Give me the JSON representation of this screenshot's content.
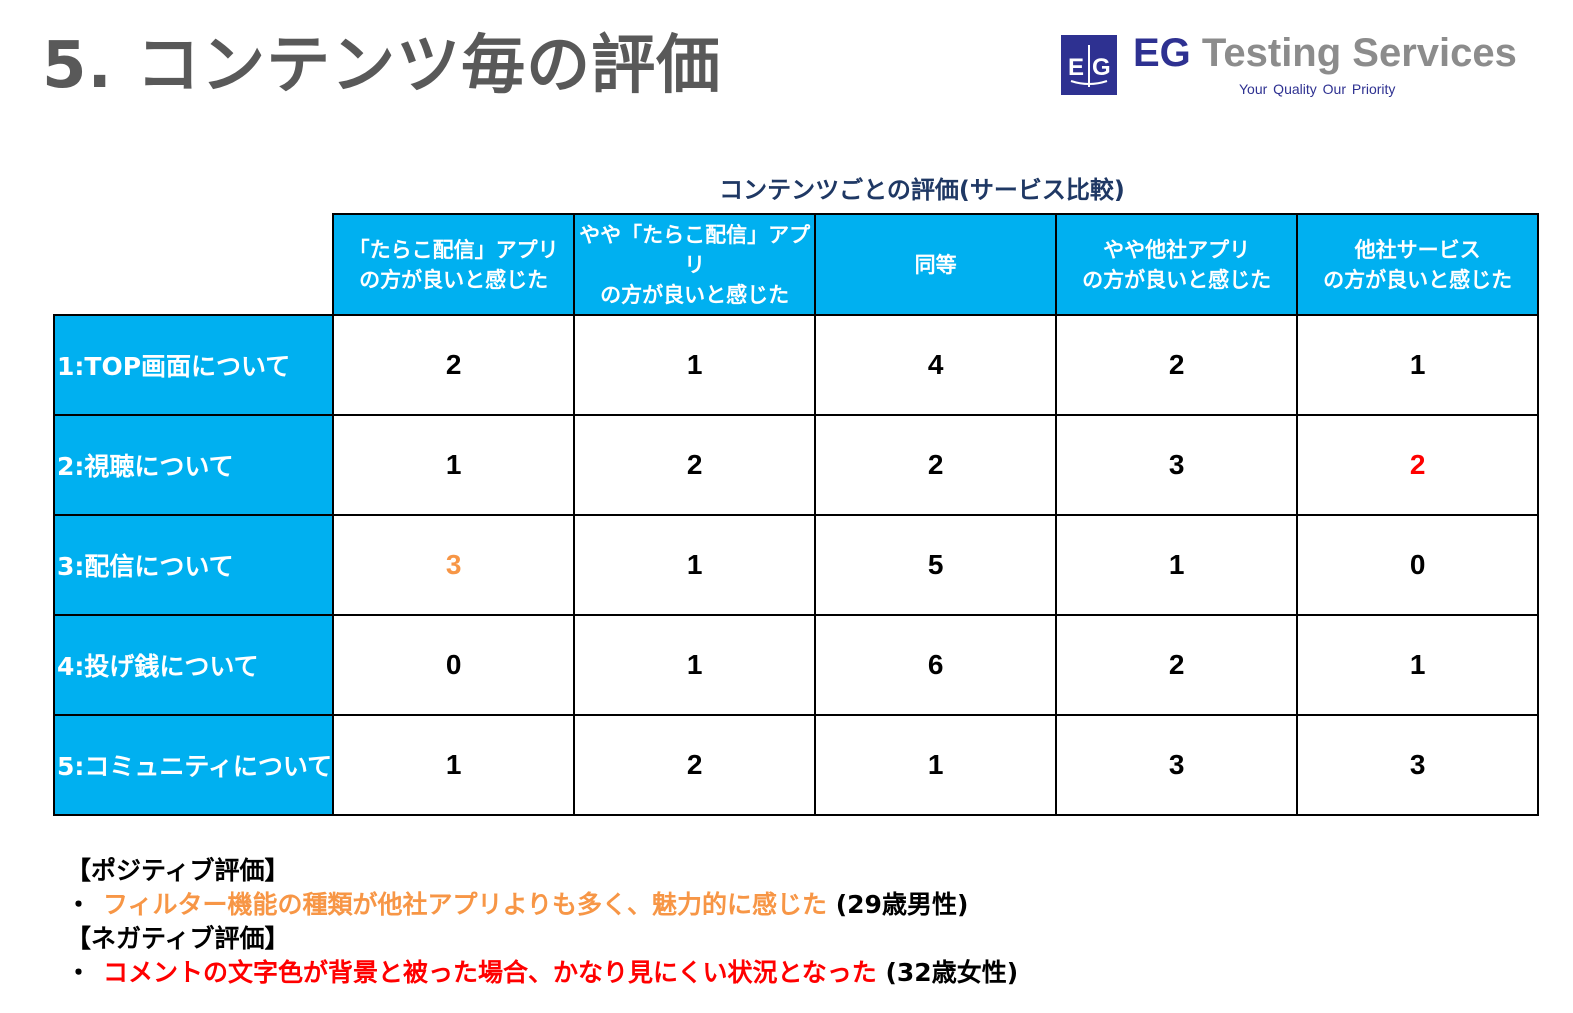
{
  "page": {
    "title": "5. コンテンツ毎の評価"
  },
  "logo": {
    "mark_icon": "eg-logo-mark-icon",
    "name_part1": "EG",
    "name_part2": " Testing Services",
    "tagline": "Your Quality  Our Priority",
    "colors": {
      "brand_navy": "#2e3191",
      "brand_gray": "#8c8c8c"
    }
  },
  "table": {
    "title": "コンテンツごとの評価(サービス比較)",
    "header_color": "#00b0f0",
    "columns": [
      "「たらこ配信」アプリ\nの方が良いと感じた",
      "やや「たらこ配信」アプリ\nの方が良いと感じた",
      "同等",
      "やや他社アプリ\nの方が良いと感じた",
      "他社サービス\nの方が良いと感じた"
    ],
    "rows": [
      {
        "label": "1:TOP画面について",
        "values": [
          "2",
          "1",
          "4",
          "2",
          "1"
        ],
        "colors": [
          "#000000",
          "#000000",
          "#000000",
          "#000000",
          "#000000"
        ]
      },
      {
        "label": "2:視聴について",
        "values": [
          "1",
          "2",
          "2",
          "3",
          "2"
        ],
        "colors": [
          "#000000",
          "#000000",
          "#000000",
          "#000000",
          "#ff0000"
        ]
      },
      {
        "label": "3:配信について",
        "values": [
          "3",
          "1",
          "5",
          "1",
          "0"
        ],
        "colors": [
          "#f79646",
          "#000000",
          "#000000",
          "#000000",
          "#000000"
        ]
      },
      {
        "label": "4:投げ銭について",
        "values": [
          "0",
          "1",
          "6",
          "2",
          "1"
        ],
        "colors": [
          "#000000",
          "#000000",
          "#000000",
          "#000000",
          "#000000"
        ]
      },
      {
        "label": "5:コミュニティについて",
        "values": [
          "1",
          "2",
          "1",
          "3",
          "3"
        ],
        "colors": [
          "#000000",
          "#000000",
          "#000000",
          "#000000",
          "#000000"
        ]
      }
    ]
  },
  "comments": {
    "positive_heading": "【ポジティブ評価】",
    "positive_bullet": "・",
    "positive_text": "フィルター機能の種類が他社アプリよりも多く、魅力的に感じた",
    "positive_author": " (29歳男性)",
    "positive_color": "#f79646",
    "negative_heading": "【ネガティブ評価】",
    "negative_bullet": "・",
    "negative_text": "コメントの文字色が背景と被った場合、かなり見にくい状況となった",
    "negative_author": " (32歳女性)",
    "negative_color": "#ff0000"
  }
}
